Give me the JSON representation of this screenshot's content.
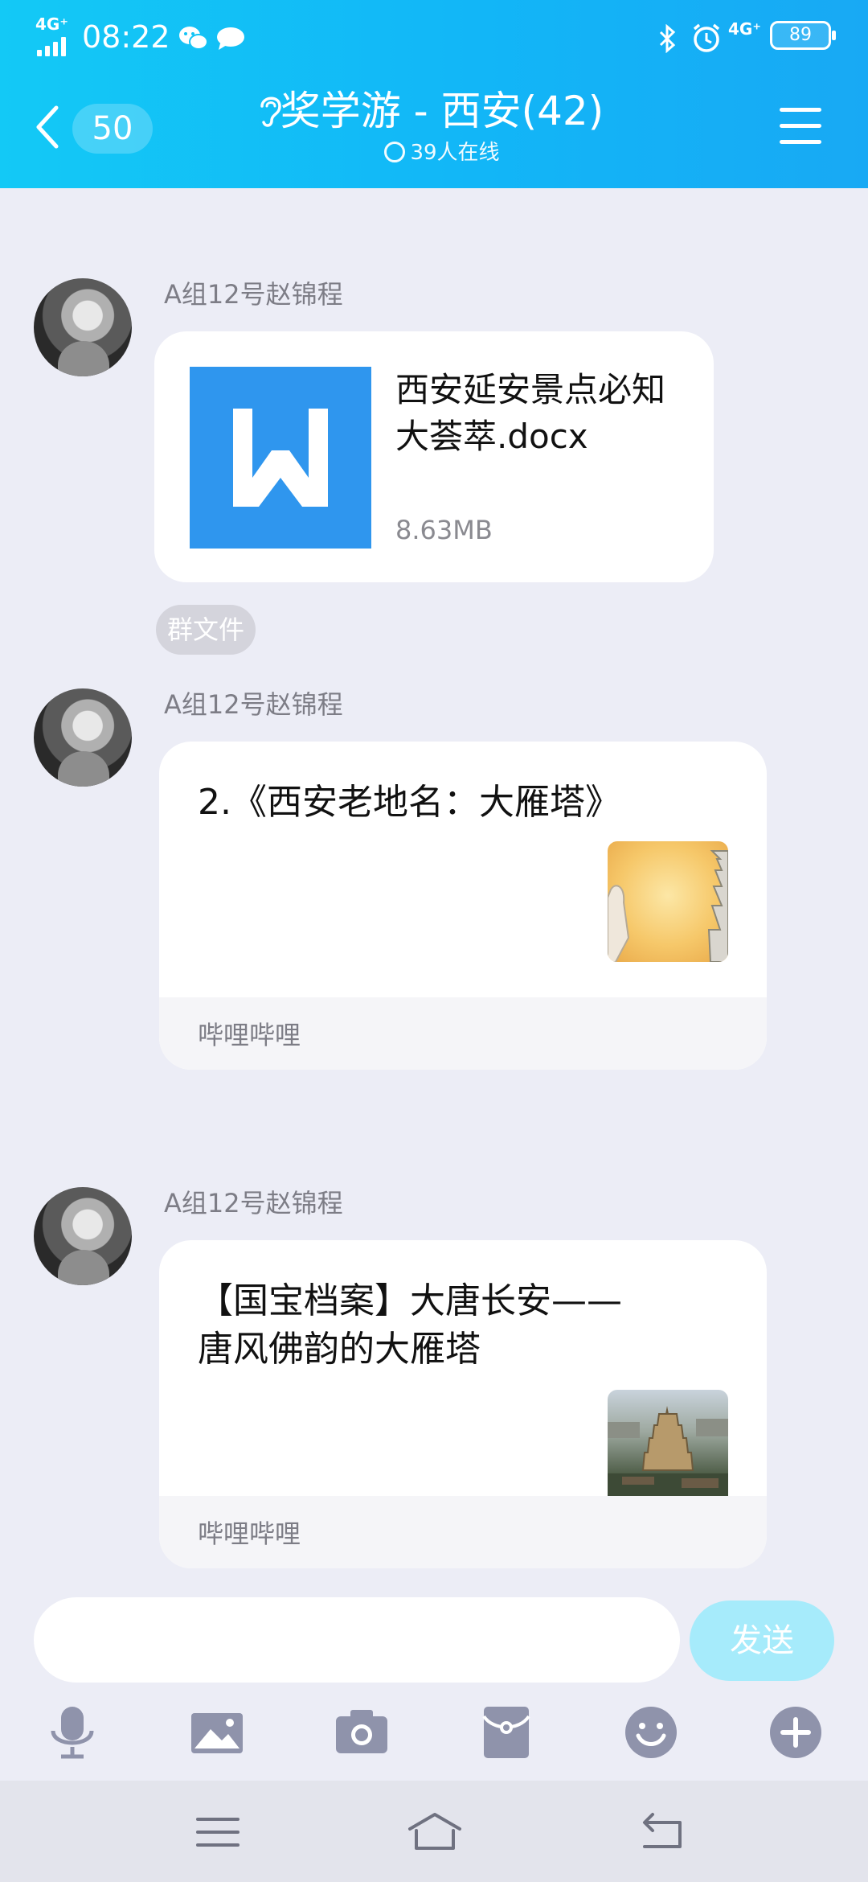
{
  "status_bar": {
    "network_left": "4G⁺",
    "time": "08:22",
    "network_right": "4G⁺",
    "battery": "89"
  },
  "header": {
    "unread_count": "50",
    "title": "奖学游 - 西安(42)",
    "online": "39人在线"
  },
  "messages": [
    {
      "type": "file",
      "sender": "A组12号赵锦程",
      "file_name": "西安延安景点必知大荟萃.docx",
      "file_size": "8.63MB",
      "tag": "群文件"
    },
    {
      "type": "link",
      "sender": "A组12号赵锦程",
      "title": "2.《西安老地名：大雁塔》",
      "source": "哔哩哔哩"
    },
    {
      "type": "link",
      "sender": "A组12号赵锦程",
      "title": "【国宝档案】大唐长安——唐风佛韵的大雁塔",
      "source": "哔哩哔哩"
    }
  ],
  "input": {
    "placeholder": "",
    "send_label": "发送"
  },
  "toolbar": [
    "microphone-icon",
    "image-icon",
    "camera-icon",
    "red-packet-icon",
    "emoji-icon",
    "plus-icon"
  ],
  "colors": {
    "header_start": "#13c9f6",
    "header_end": "#18a9f4",
    "background": "#ecedf6",
    "send_disabled": "#a6ebfb",
    "word_icon": "#2f96ee",
    "toolbar_icon": "#8f93ab"
  }
}
